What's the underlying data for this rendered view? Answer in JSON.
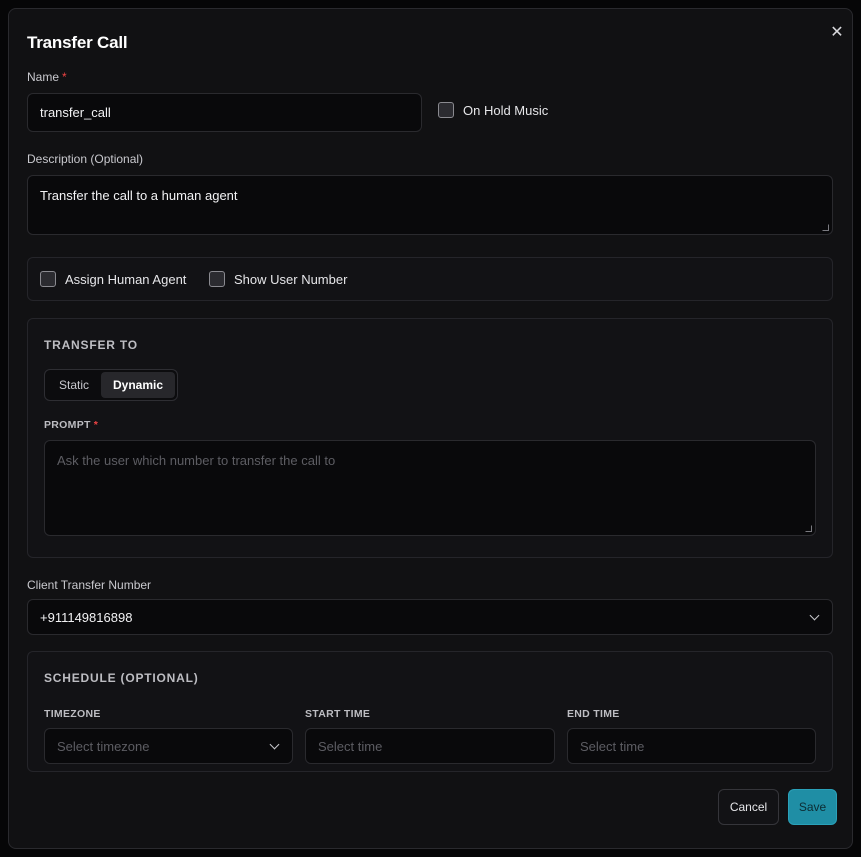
{
  "dialog": {
    "title": "Transfer Call",
    "close_label": "✕"
  },
  "name_field": {
    "label": "Name",
    "required_mark": "*",
    "value": "transfer_call"
  },
  "on_hold_music": {
    "label": "On Hold Music",
    "checked": false
  },
  "description_field": {
    "label": "Description (Optional)",
    "value": "Transfer the call to a human agent"
  },
  "options": {
    "assign_human_agent": {
      "label": "Assign Human Agent",
      "checked": false
    },
    "show_user_number": {
      "label": "Show User Number",
      "checked": false
    }
  },
  "transfer_to": {
    "heading": "TRANSFER TO",
    "tabs": [
      {
        "label": "Static",
        "active": false
      },
      {
        "label": "Dynamic",
        "active": true
      }
    ],
    "prompt_label": "PROMPT",
    "prompt_required_mark": "*",
    "prompt_placeholder": "Ask the user which number to transfer the call to"
  },
  "client_transfer": {
    "label": "Client Transfer Number",
    "value": "+911149816898"
  },
  "schedule": {
    "heading": "SCHEDULE (OPTIONAL)",
    "timezone_label": "TIMEZONE",
    "timezone_placeholder": "Select timezone",
    "start_label": "START TIME",
    "start_placeholder": "Select time",
    "end_label": "END TIME",
    "end_placeholder": "Select time"
  },
  "footer": {
    "cancel_label": "Cancel",
    "save_label": "Save"
  },
  "colors": {
    "accent": "#1f8ea5",
    "required": "#ef4444",
    "background": "#111113"
  }
}
